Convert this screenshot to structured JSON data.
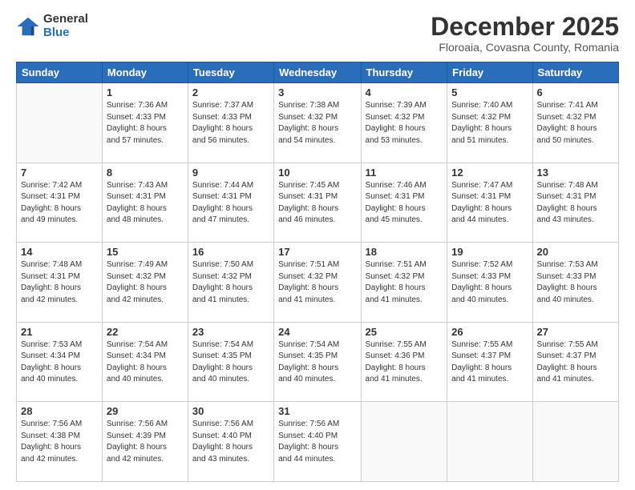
{
  "header": {
    "logo_general": "General",
    "logo_blue": "Blue",
    "month_title": "December 2025",
    "location": "Floroaia, Covasna County, Romania"
  },
  "days_of_week": [
    "Sunday",
    "Monday",
    "Tuesday",
    "Wednesday",
    "Thursday",
    "Friday",
    "Saturday"
  ],
  "weeks": [
    [
      {
        "day": "",
        "info": ""
      },
      {
        "day": "1",
        "info": "Sunrise: 7:36 AM\nSunset: 4:33 PM\nDaylight: 8 hours\nand 57 minutes."
      },
      {
        "day": "2",
        "info": "Sunrise: 7:37 AM\nSunset: 4:33 PM\nDaylight: 8 hours\nand 56 minutes."
      },
      {
        "day": "3",
        "info": "Sunrise: 7:38 AM\nSunset: 4:32 PM\nDaylight: 8 hours\nand 54 minutes."
      },
      {
        "day": "4",
        "info": "Sunrise: 7:39 AM\nSunset: 4:32 PM\nDaylight: 8 hours\nand 53 minutes."
      },
      {
        "day": "5",
        "info": "Sunrise: 7:40 AM\nSunset: 4:32 PM\nDaylight: 8 hours\nand 51 minutes."
      },
      {
        "day": "6",
        "info": "Sunrise: 7:41 AM\nSunset: 4:32 PM\nDaylight: 8 hours\nand 50 minutes."
      }
    ],
    [
      {
        "day": "7",
        "info": "Sunrise: 7:42 AM\nSunset: 4:31 PM\nDaylight: 8 hours\nand 49 minutes."
      },
      {
        "day": "8",
        "info": "Sunrise: 7:43 AM\nSunset: 4:31 PM\nDaylight: 8 hours\nand 48 minutes."
      },
      {
        "day": "9",
        "info": "Sunrise: 7:44 AM\nSunset: 4:31 PM\nDaylight: 8 hours\nand 47 minutes."
      },
      {
        "day": "10",
        "info": "Sunrise: 7:45 AM\nSunset: 4:31 PM\nDaylight: 8 hours\nand 46 minutes."
      },
      {
        "day": "11",
        "info": "Sunrise: 7:46 AM\nSunset: 4:31 PM\nDaylight: 8 hours\nand 45 minutes."
      },
      {
        "day": "12",
        "info": "Sunrise: 7:47 AM\nSunset: 4:31 PM\nDaylight: 8 hours\nand 44 minutes."
      },
      {
        "day": "13",
        "info": "Sunrise: 7:48 AM\nSunset: 4:31 PM\nDaylight: 8 hours\nand 43 minutes."
      }
    ],
    [
      {
        "day": "14",
        "info": "Sunrise: 7:48 AM\nSunset: 4:31 PM\nDaylight: 8 hours\nand 42 minutes."
      },
      {
        "day": "15",
        "info": "Sunrise: 7:49 AM\nSunset: 4:32 PM\nDaylight: 8 hours\nand 42 minutes."
      },
      {
        "day": "16",
        "info": "Sunrise: 7:50 AM\nSunset: 4:32 PM\nDaylight: 8 hours\nand 41 minutes."
      },
      {
        "day": "17",
        "info": "Sunrise: 7:51 AM\nSunset: 4:32 PM\nDaylight: 8 hours\nand 41 minutes."
      },
      {
        "day": "18",
        "info": "Sunrise: 7:51 AM\nSunset: 4:32 PM\nDaylight: 8 hours\nand 41 minutes."
      },
      {
        "day": "19",
        "info": "Sunrise: 7:52 AM\nSunset: 4:33 PM\nDaylight: 8 hours\nand 40 minutes."
      },
      {
        "day": "20",
        "info": "Sunrise: 7:53 AM\nSunset: 4:33 PM\nDaylight: 8 hours\nand 40 minutes."
      }
    ],
    [
      {
        "day": "21",
        "info": "Sunrise: 7:53 AM\nSunset: 4:34 PM\nDaylight: 8 hours\nand 40 minutes."
      },
      {
        "day": "22",
        "info": "Sunrise: 7:54 AM\nSunset: 4:34 PM\nDaylight: 8 hours\nand 40 minutes."
      },
      {
        "day": "23",
        "info": "Sunrise: 7:54 AM\nSunset: 4:35 PM\nDaylight: 8 hours\nand 40 minutes."
      },
      {
        "day": "24",
        "info": "Sunrise: 7:54 AM\nSunset: 4:35 PM\nDaylight: 8 hours\nand 40 minutes."
      },
      {
        "day": "25",
        "info": "Sunrise: 7:55 AM\nSunset: 4:36 PM\nDaylight: 8 hours\nand 41 minutes."
      },
      {
        "day": "26",
        "info": "Sunrise: 7:55 AM\nSunset: 4:37 PM\nDaylight: 8 hours\nand 41 minutes."
      },
      {
        "day": "27",
        "info": "Sunrise: 7:55 AM\nSunset: 4:37 PM\nDaylight: 8 hours\nand 41 minutes."
      }
    ],
    [
      {
        "day": "28",
        "info": "Sunrise: 7:56 AM\nSunset: 4:38 PM\nDaylight: 8 hours\nand 42 minutes."
      },
      {
        "day": "29",
        "info": "Sunrise: 7:56 AM\nSunset: 4:39 PM\nDaylight: 8 hours\nand 42 minutes."
      },
      {
        "day": "30",
        "info": "Sunrise: 7:56 AM\nSunset: 4:40 PM\nDaylight: 8 hours\nand 43 minutes."
      },
      {
        "day": "31",
        "info": "Sunrise: 7:56 AM\nSunset: 4:40 PM\nDaylight: 8 hours\nand 44 minutes."
      },
      {
        "day": "",
        "info": ""
      },
      {
        "day": "",
        "info": ""
      },
      {
        "day": "",
        "info": ""
      }
    ]
  ]
}
